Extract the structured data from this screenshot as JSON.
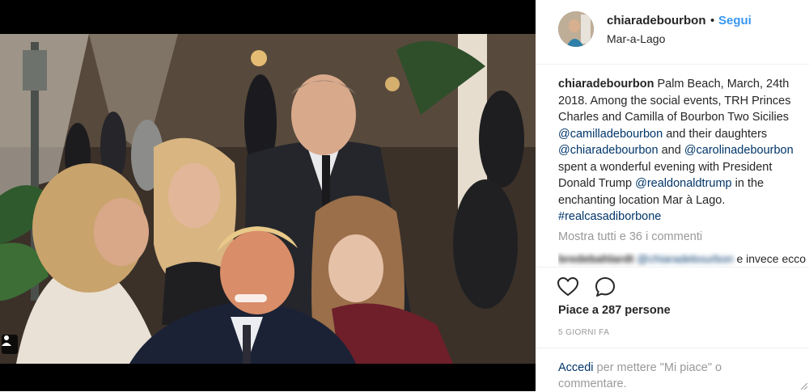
{
  "header": {
    "username": "chiaradebourbon",
    "dot": "•",
    "follow_label": "Segui",
    "location": "Mar-a-Lago"
  },
  "caption": {
    "username": "chiaradebourbon",
    "part1": " Palm Beach, March, 24th 2018. Among the social events, TRH Princes Charles and Camilla of Bourbon Two Sicilies ",
    "mention1": "@camilladebourbon",
    "part2": " and their daughters ",
    "mention2": "@chiaradebourbon",
    "part3": " and ",
    "mention3": "@carolinadebourbon",
    "part4": " spent a wonderful evening with President Donald Trump ",
    "mention4": "@realdonaldtrump",
    "part5": " in the enchanting location Mar à Lago. ",
    "hashtag": "#realcasadiborbone"
  },
  "comments": {
    "view_all_label": "Mostra tutti e 36 i commenti",
    "first": {
      "user": "bredebahlardt",
      "mention": "@chiaradebourbon",
      "text": "e invece eccoli"
    }
  },
  "actions": {
    "like_icon": "heart-icon",
    "comment_icon": "comment-bubble-icon",
    "likes_label": "Piace a 287 persone",
    "timestamp": "5 GIORNI FA"
  },
  "login": {
    "link": "Accedi",
    "text": " per mettere \"Mi piace\" o commentare."
  },
  "colors": {
    "link": "#003569",
    "follow": "#3897f0",
    "muted": "#999999",
    "text": "#262626",
    "divider": "#efefef"
  }
}
